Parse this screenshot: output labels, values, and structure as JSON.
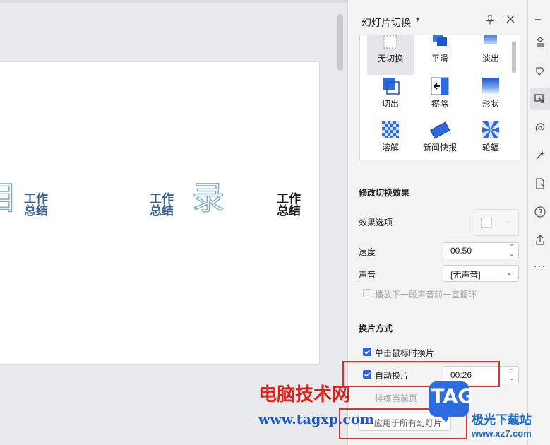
{
  "slide": {
    "chars": [
      "目",
      "录"
    ],
    "items": [
      "工作总结",
      "工作总结",
      "工作总结"
    ]
  },
  "pane": {
    "title": "幻灯片切换",
    "transitions": [
      {
        "label": "无切换",
        "icon": "none-icon"
      },
      {
        "label": "平滑",
        "icon": "smooth-icon"
      },
      {
        "label": "淡出",
        "icon": "fade-icon"
      },
      {
        "label": "切出",
        "icon": "cut-icon"
      },
      {
        "label": "擦除",
        "icon": "wipe-icon"
      },
      {
        "label": "形状",
        "icon": "shape-icon"
      },
      {
        "label": "溶解",
        "icon": "dissolve-icon"
      },
      {
        "label": "新闻快报",
        "icon": "newsflash-icon"
      },
      {
        "label": "轮辐",
        "icon": "wheel-icon"
      }
    ],
    "selected_transition": "无切换",
    "modify_section": "修改切换效果",
    "effect_options_label": "效果选项",
    "speed_label": "速度",
    "speed_value": "00.50",
    "sound_label": "声音",
    "sound_value": "[无声音]",
    "loop_label": "播放下一段声音前一直循环",
    "advance_section": "换片方式",
    "on_click_label": "单击鼠标时换片",
    "on_click_checked": true,
    "auto_label": "自动换片",
    "auto_checked": true,
    "auto_value": "00:26",
    "apply_current_label": "排练当前页",
    "apply_all_label": "应用于所有幻灯片"
  },
  "watermark": {
    "cn": "电脑技术网",
    "url": "www.tagxp.com",
    "badge": "TAG",
    "site_cn": "极光下载站",
    "site_url": "www.xz7.com"
  },
  "colors": {
    "accent": "#2c64d8",
    "highlight": "#d9342b",
    "slide_text": "#3a5f8f"
  }
}
